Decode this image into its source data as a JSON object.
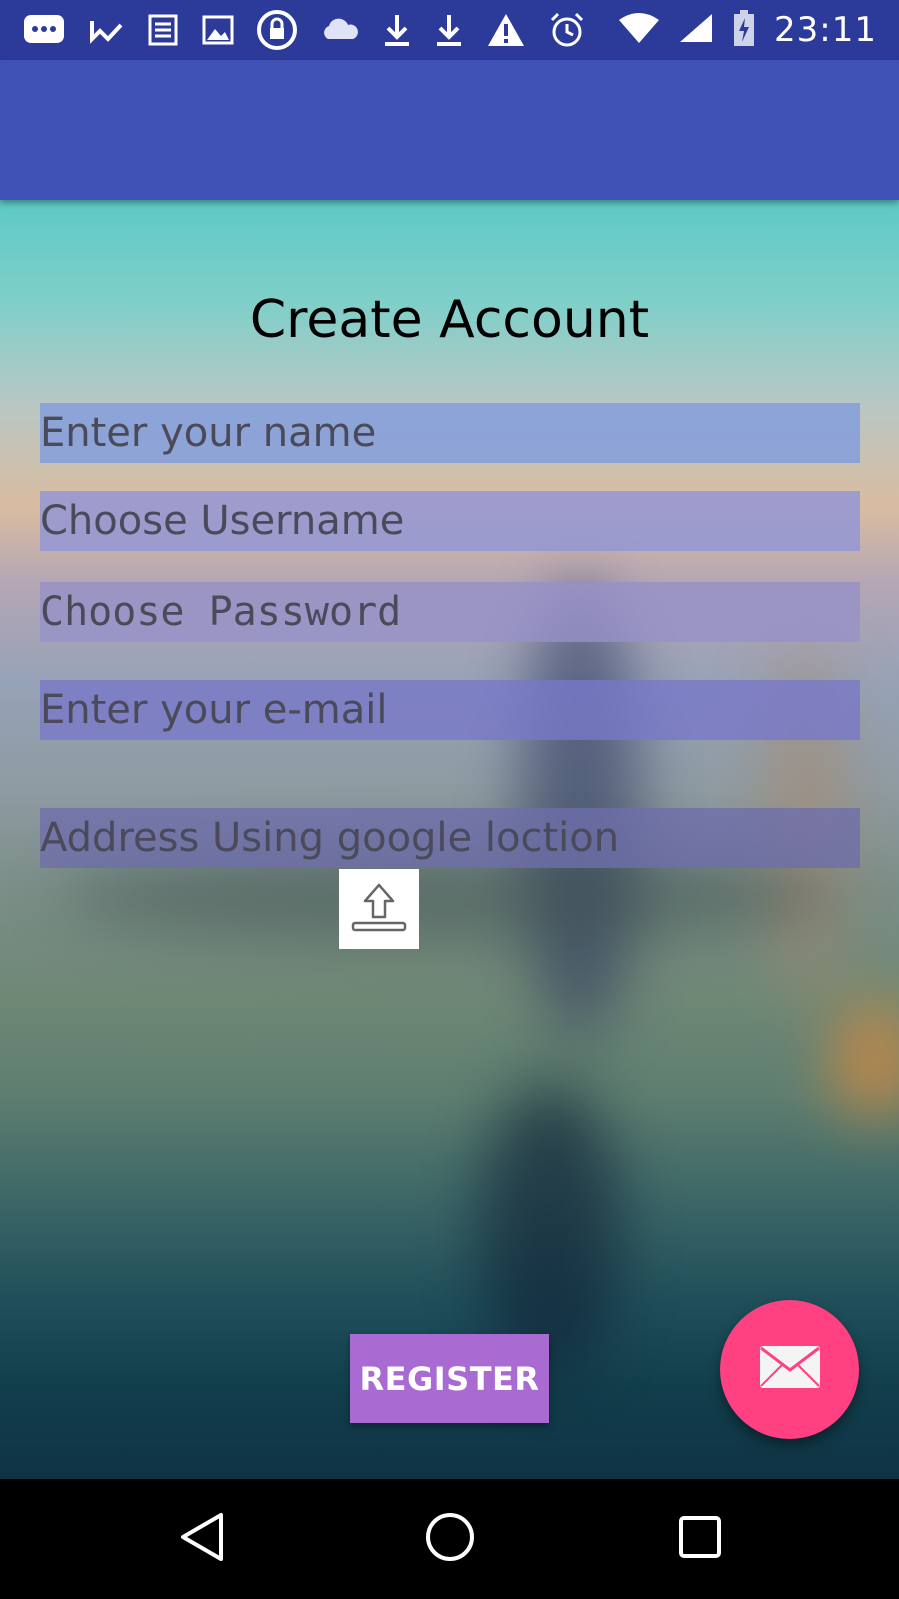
{
  "status_bar": {
    "time": "23:11",
    "icons": [
      "chat-icon",
      "check-icon",
      "news-icon",
      "image-icon",
      "lock-icon",
      "cloud-icon",
      "download-icon",
      "download-icon",
      "warning-icon",
      "alarm-icon",
      "wifi-icon",
      "signal-icon",
      "battery-charging-icon"
    ]
  },
  "screen": {
    "title": "Create Account"
  },
  "form": {
    "name_placeholder": "Enter your name",
    "username_placeholder": "Choose Username",
    "password_placeholder": "Choose Password",
    "email_placeholder": "Enter your e-mail",
    "address_placeholder": "Address Using google loction",
    "upload_icon": "upload-icon",
    "register_label": "REGISTER"
  },
  "fab": {
    "icon": "mail-icon"
  },
  "nav_bar": {
    "icons": [
      "back-icon",
      "home-icon",
      "recents-icon"
    ]
  },
  "colors": {
    "app_bar": "#3f51b5",
    "status_bar": "#2c3a9a",
    "register_button": "#a96ad2",
    "fab": "#ff4081"
  }
}
